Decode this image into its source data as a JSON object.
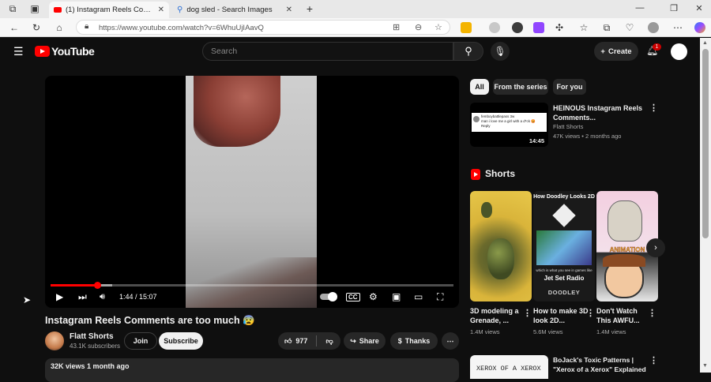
{
  "browser": {
    "tabs": [
      {
        "title": "(1) Instagram Reels Comments ar",
        "active": true
      },
      {
        "title": "dog sled - Search Images",
        "active": false
      }
    ],
    "new_tab": "+",
    "url": "https://www.youtube.com/watch?v=6WhuUjIAavQ"
  },
  "youtube": {
    "logo_text": "YouTube",
    "search_placeholder": "Search",
    "create_label": "Create",
    "notification_count": "1"
  },
  "player": {
    "time": "1:44 / 15:07",
    "progress_fraction": 0.115,
    "buffered_fraction": 0.153
  },
  "video": {
    "title": "Instagram Reels Comments are too much 😰",
    "channel": "Flatt Shorts",
    "subscribers": "43.1K subscribers",
    "join_label": "Join",
    "subscribe_label": "Subscribe",
    "likes": "977",
    "share_label": "Share",
    "thanks_label": "Thanks",
    "views_date": "32K views  1 month ago"
  },
  "sidebar": {
    "chips": [
      "All",
      "From the series",
      "For you"
    ],
    "rec": {
      "title": "HEINOUS Instagram Reels Comments...",
      "channel": "Flatt Shorts",
      "meta": "47K views • 2 months ago",
      "duration": "14:45",
      "thumb_user": "femboybattlepass 3w",
      "thumb_text": "man i love me a girl with a d*ck 😡",
      "thumb_reply": "Reply"
    },
    "shorts_heading": "Shorts",
    "shorts": [
      {
        "title": "3D modeling a Grenade, ...",
        "views": "1.4M views",
        "overlay": ""
      },
      {
        "title": "How to make 3D look 2D...",
        "views": "5.6M views",
        "overlay": "How Doodley Looks 2D",
        "bottom1": "which is what you see in games like",
        "bottom2": "Jet Set Radio",
        "bottom3": "DOODLEY"
      },
      {
        "title": "Don't Watch This AWFU...",
        "views": "1.4M views",
        "overlay": "ANIMATION"
      }
    ],
    "bottom": {
      "title": "BoJack's Toxic Patterns | \"Xerox of a Xerox\" Explained",
      "thumb_text": "XEROX OF A XEROX"
    }
  },
  "colors": {
    "accent": "#ff0000",
    "bg": "#0f0f0f",
    "chip": "#272727"
  }
}
